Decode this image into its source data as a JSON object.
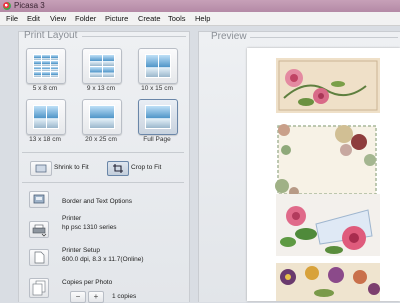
{
  "window": {
    "title": "Picasa 3"
  },
  "menu": {
    "items": [
      "File",
      "Edit",
      "View",
      "Folder",
      "Picture",
      "Create",
      "Tools",
      "Help"
    ]
  },
  "print_layout": {
    "title": "Print Layout",
    "layouts": [
      {
        "label": "5 x 8 cm",
        "icon": "photo-grid-4x3-icon"
      },
      {
        "label": "9 x 13 cm",
        "icon": "photo-grid-2x2-icon"
      },
      {
        "label": "10 x 15 cm",
        "icon": "photo-grid-1x2-icon"
      },
      {
        "label": "13 x 18 cm",
        "icon": "photo-grid-1x2-icon"
      },
      {
        "label": "20 x 25 cm",
        "icon": "photo-single-icon"
      },
      {
        "label": "Full Page",
        "icon": "photo-full-page-icon",
        "selected": true
      }
    ],
    "fit": {
      "shrink_label": "Shrink to Fit",
      "crop_label": "Crop to Fit",
      "selected": "crop"
    },
    "border_options_label": "Border and Text Options",
    "printer": {
      "heading": "Printer",
      "name": "hp psc 1310 series"
    },
    "printer_setup": {
      "heading": "Printer Setup",
      "details": "600.0 dpi, 8.3 x 11.7(Online)"
    },
    "copies": {
      "heading": "Copies per Photo",
      "minus": "−",
      "plus": "+",
      "value": "1 copies"
    }
  },
  "preview": {
    "title": "Preview"
  }
}
